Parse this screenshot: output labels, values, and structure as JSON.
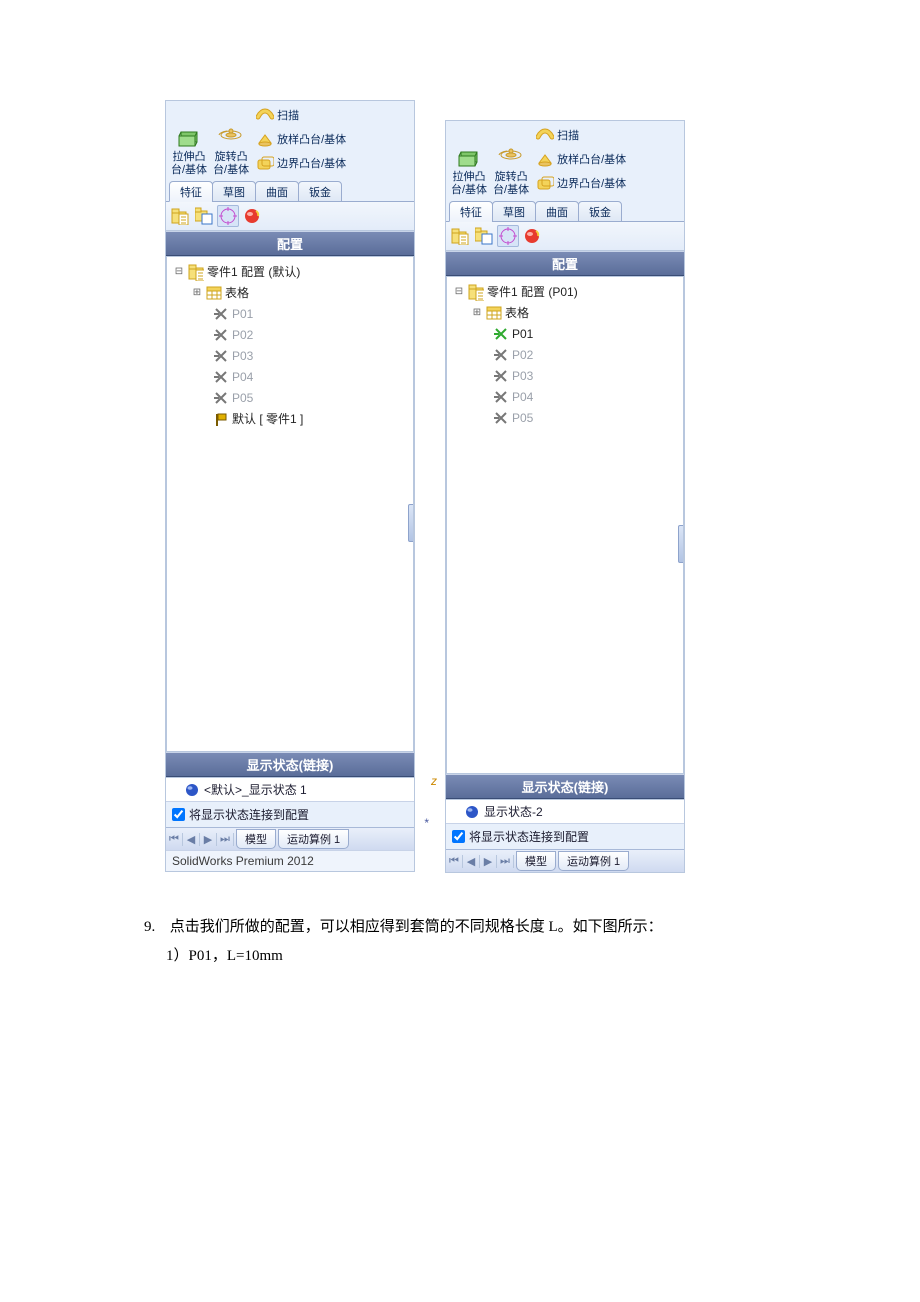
{
  "ribbon": {
    "extrude_l1": "拉伸凸",
    "extrude_l2": "台/基体",
    "revolve_l1": "旋转凸",
    "revolve_l2": "台/基体",
    "sweep": "扫描",
    "loft": "放样凸台/基体",
    "loft_short": "放样凸台/基体",
    "boundary": "边界凸台/基体",
    "boundary_short": "边界凸台/基体"
  },
  "tabs": {
    "feature": "特征",
    "sketch": "草图",
    "surface": "曲面",
    "sheetmetal": "钣金",
    "sheetmetal_short": "钣金"
  },
  "section": {
    "config": "配置",
    "display_state": "显示状态(链接)"
  },
  "left": {
    "root": "零件1 配置  (默认)",
    "tables": "表格",
    "items": [
      "P01",
      "P02",
      "P03",
      "P04",
      "P05"
    ],
    "default_cfg": "默认 [ 零件1 ]",
    "ds_item": "<默认>_显示状态 1",
    "link_label": "将显示状态连接到配置",
    "sheet_model": "模型",
    "sheet_motion": "运动算例 1",
    "status": "SolidWorks Premium 2012"
  },
  "right": {
    "root": "零件1 配置  (P01)",
    "tables": "表格",
    "items": [
      "P01",
      "P02",
      "P03",
      "P04",
      "P05"
    ],
    "ds_item": "显示状态-2",
    "link_label": "将显示状态连接到配置",
    "sheet_model": "模型",
    "sheet_motion": "运动算例 1"
  },
  "text": {
    "li_num": "9.",
    "li_main": "点击我们所做的配置，可以相应得到套筒的不同规格长度 L。如下图所示：",
    "li_sub": "1）P01，L=10mm"
  }
}
